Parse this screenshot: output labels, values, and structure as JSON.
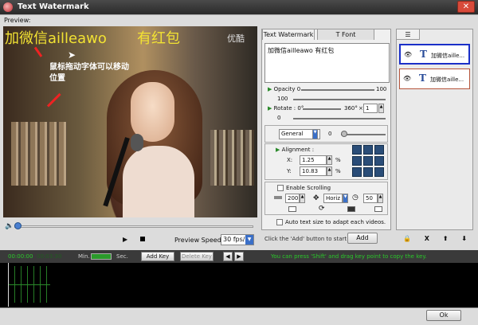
{
  "window": {
    "title": "Text Watermark",
    "close_glyph": "✕"
  },
  "preview": {
    "label": "Preview:",
    "overlay_text_1": "加微信ailleawo",
    "overlay_text_2": "有红包",
    "channel_logo": "优酷",
    "annotation_line1": "鼠标拖动字体可以移动",
    "annotation_line2": "位置",
    "playback_position": 0.0,
    "watermark_color": "#f2e233"
  },
  "playback": {
    "play_glyph": "▶",
    "speed_label": "Preview Speed:",
    "speed_value": "30 fps/s"
  },
  "tabs": {
    "text_watermark": "Text Watermark",
    "font": "T Font"
  },
  "text_panel": {
    "input_value": "加微信ailleawo   有红包",
    "opacity_label": "Opacity",
    "opacity_min": "0",
    "opacity_max": "100",
    "opacity_value": "100",
    "rotate_label": "Rotate",
    "rotate_min": ": 0°",
    "rotate_max": "360°",
    "rotate_times": "×",
    "rotate_spin": "1",
    "rotate_value": "0",
    "general_select": "General",
    "general_value": "0",
    "alignment_label": "Alignment :",
    "x_label": "X:",
    "x_value": "1.25",
    "y_label": "Y:",
    "y_value": "10.83",
    "pct": "%",
    "scrolling_label": "Enable Scrolling",
    "scroll_speed": "200",
    "scroll_direction": "Horiz",
    "scroll_time": "50",
    "auto_size_label": "Auto text size to adapt each videos.",
    "add_hint": "Click the 'Add' button to start ->",
    "add_button": "Add"
  },
  "layers": {
    "items": [
      {
        "label": "加微信aille...",
        "selected": true
      },
      {
        "label": "加微信aille...",
        "selected": false
      }
    ],
    "actions": [
      "🔒",
      "X",
      "⬆",
      "⬇"
    ]
  },
  "timeline": {
    "time_start": "00:00:00",
    "time_end": "00:03:30",
    "min_label": "Min.",
    "sec_label": "Sec.",
    "add_key": "Add Key",
    "delete_key": "Delete Key",
    "hint": "You can press 'Shift' and drag key point to copy the key."
  },
  "footer": {
    "ok": "Ok"
  }
}
